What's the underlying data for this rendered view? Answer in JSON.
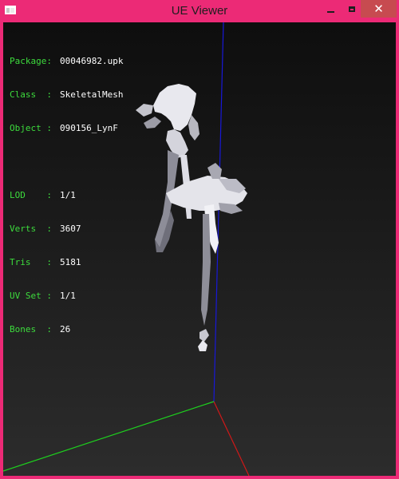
{
  "window": {
    "title": "UE Viewer"
  },
  "titlebar_buttons": {
    "close_glyph": "✕"
  },
  "info": {
    "package_label": "Package:",
    "package_value": "00046982.upk",
    "class_label": "Class  :",
    "class_value": "SkeletalMesh",
    "object_label": "Object :",
    "object_value": "090156_LynF",
    "lod_label": "LOD    :",
    "lod_value": "1/1",
    "verts_label": "Verts  :",
    "verts_value": "3607",
    "tris_label": "Tris   :",
    "tris_value": "5181",
    "uvset_label": "UV Set :",
    "uvset_value": "1/1",
    "bones_label": "Bones  :",
    "bones_value": "26"
  },
  "colors": {
    "window_frame": "#ec2a76",
    "close_button": "#c74b50",
    "label_text": "#3ddc3d",
    "value_text": "#ffffff",
    "axis_x": "#d01818",
    "axis_y": "#1ed01e",
    "axis_z": "#1818d8",
    "mesh": "#d8d8e0"
  }
}
